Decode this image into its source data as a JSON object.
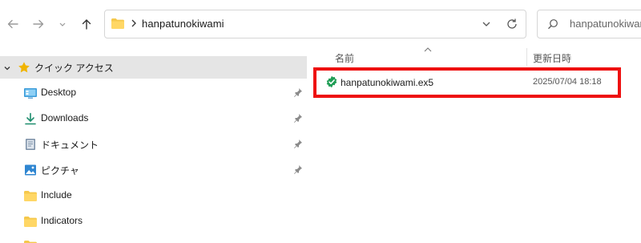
{
  "address_bar": {
    "path": "hanpatunokiwami"
  },
  "search": {
    "text": "hanpatunokiwami"
  },
  "sidebar": {
    "quick_access_label": "クイック アクセス",
    "items": [
      {
        "label": "Desktop",
        "icon": "desktop-icon",
        "pinned": true
      },
      {
        "label": "Downloads",
        "icon": "download-icon",
        "pinned": true
      },
      {
        "label": "ドキュメント",
        "icon": "document-icon",
        "pinned": true
      },
      {
        "label": "ピクチャ",
        "icon": "pictures-icon",
        "pinned": true
      },
      {
        "label": "Include",
        "icon": "folder-icon",
        "pinned": false
      },
      {
        "label": "Indicators",
        "icon": "folder-icon",
        "pinned": false
      }
    ]
  },
  "columns": {
    "name": "名前",
    "date": "更新日時"
  },
  "files": [
    {
      "name": "hanpatunokiwami.ex5",
      "date": "2025/07/04 18:18",
      "icon": "ex5-file-icon"
    }
  ],
  "colors": {
    "highlight": "#ee1111",
    "selected_bg": "#e5e5e5",
    "folder": "#f5c84c",
    "accent": "#1a7fd4"
  }
}
